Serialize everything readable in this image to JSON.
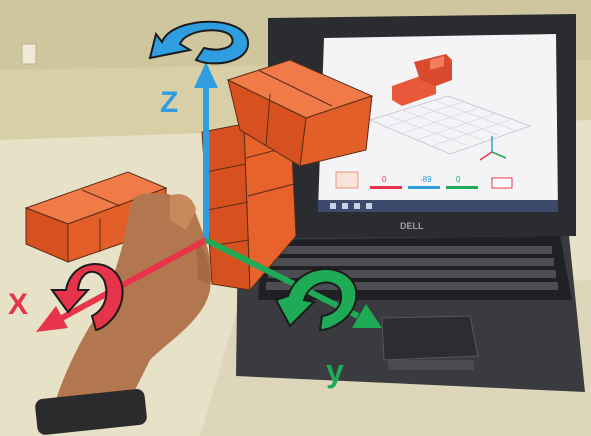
{
  "axes": {
    "x": {
      "label": "X",
      "color": "#e8344a"
    },
    "y": {
      "label": "y",
      "color": "#1faa55"
    },
    "z": {
      "label": "Z",
      "color": "#2f9ee0"
    }
  },
  "block_color": "#e85c2a",
  "screen": {
    "values": [
      "0",
      "-89",
      "0"
    ],
    "value_colors": [
      "#e8344a",
      "#2f9ee0",
      "#1faa55"
    ],
    "brand": "DELL"
  }
}
